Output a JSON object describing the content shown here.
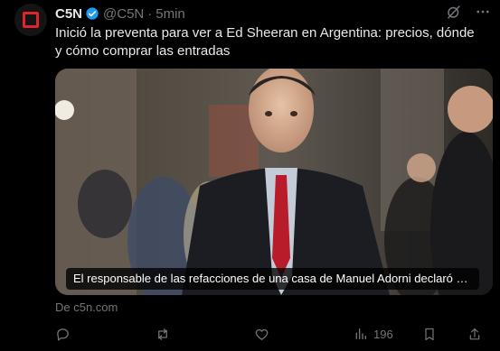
{
  "tweet": {
    "author_name": "C5N",
    "handle": "@C5N",
    "separator": "·",
    "time": "5min",
    "text": "Inició la preventa para ver a Ed Sheeran en Argentina: precios, dónde y cómo comprar las entradas"
  },
  "card": {
    "caption": "El responsable de las refacciones de una casa de Manuel Adorni declaró que e...",
    "source": "De c5n.com"
  },
  "actions": {
    "views": "196"
  },
  "colors": {
    "background": "#000000",
    "text": "#e7e9ea",
    "muted": "#71767b",
    "verified": "#1d9bf0",
    "brand": "#e0242b"
  }
}
